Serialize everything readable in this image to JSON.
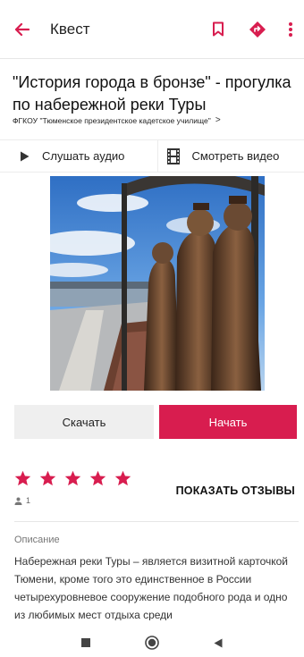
{
  "app_bar": {
    "title": "Квест",
    "accent_color": "#d81d4f",
    "icons": [
      "arrow-back-icon",
      "bookmark-icon",
      "directions-icon",
      "more-vert-icon"
    ]
  },
  "quest": {
    "title": "\"История города в бронзе\" - прогулка по набережной реки Туры",
    "organization": "ФГКОУ \"Тюменское президентское кадетское училище\"",
    "org_chevron": ">"
  },
  "media": {
    "audio_label": "Слушать аудио",
    "video_label": "Смотреть видео"
  },
  "actions": {
    "download_label": "Скачать",
    "start_label": "Начать"
  },
  "rating": {
    "stars": 5,
    "reviews_count": "1",
    "show_reviews_label": "ПОКАЗАТЬ ОТЗЫВЫ"
  },
  "description": {
    "label": "Описание",
    "text": "Набережная реки Туры – является визитной карточкой Тюмени, кроме того это единственное в России четырехуровневое сооружение подобного рода и одно из любимых мест отдыха среди"
  },
  "system_nav": {
    "icons": [
      "recent-apps-icon",
      "home-icon",
      "back-icon"
    ]
  }
}
